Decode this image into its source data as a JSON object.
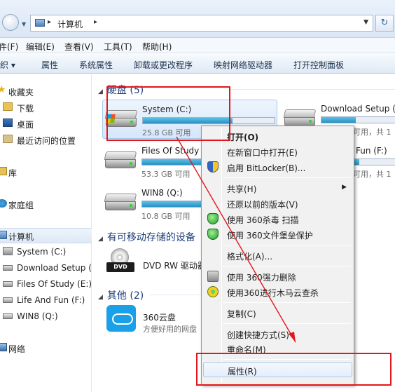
{
  "address": {
    "location": "计算机"
  },
  "menubar": [
    {
      "label": "件(F)"
    },
    {
      "label": "编辑(E)"
    },
    {
      "label": "查看(V)"
    },
    {
      "label": "工具(T)"
    },
    {
      "label": "帮助(H)"
    }
  ],
  "toolbar": [
    {
      "label": "组织 ▾"
    },
    {
      "label": "属性"
    },
    {
      "label": "系统属性"
    },
    {
      "label": "卸载或更改程序"
    },
    {
      "label": "映射网络驱动器"
    },
    {
      "label": "打开控制面板"
    }
  ],
  "nav": {
    "favorites": "收藏夹",
    "downloads": "下载",
    "desktop": "桌面",
    "recent": "最近访问的位置",
    "libraries": "库",
    "homegroup": "家庭组",
    "computer": "计算机",
    "drives": [
      {
        "label": "System (C:)"
      },
      {
        "label": "Download Setup (D:)"
      },
      {
        "label": "Files Of Study (E:)"
      },
      {
        "label": "Life And Fun (F:)"
      },
      {
        "label": "WIN8 (Q:)"
      }
    ],
    "network": "网络"
  },
  "content": {
    "groups": {
      "hdd": "硬盘 (5)",
      "removable": "有可移动存储的设备",
      "other": "其他 (2)"
    },
    "drives": [
      {
        "name": "System (C:)",
        "size": "25.8 GB 可用",
        "used": 0.68
      },
      {
        "name": "Files Of Study",
        "size": "53.3 GB 可用",
        "used": 0.55
      },
      {
        "name": "WIN8 (Q:)",
        "size": "10.8 GB 可用",
        "used": 0.72
      },
      {
        "name": "Download Setup (",
        "size": "可用，共 1",
        "used": 0.45
      },
      {
        "name": "Fun (F:)",
        "size": "可用，共 1",
        "used": 0.5
      }
    ],
    "dvd": {
      "name": "DVD RW 驱动器",
      "badge": "DVD"
    },
    "cloud": {
      "name": "360云盘",
      "desc": "方便好用的网盘"
    }
  },
  "context_menu": {
    "open": "打开(O)",
    "open_new_window": "在新窗口中打开(E)",
    "bitlocker": "启用 BitLocker(B)...",
    "share": "共享(H)",
    "restore": "还原以前的版本(V)",
    "scan360": "使用 360杀毒 扫描",
    "firewall360": "使用 360文件堡垒保护",
    "format": "格式化(A)...",
    "shred360": "使用 360强力删除",
    "trojan360": "使用360进行木马云查杀",
    "copy": "复制(C)",
    "shortcut": "创建快捷方式(S)",
    "rename": "重命名(M)",
    "properties": "属性(R)"
  },
  "colors": {
    "annotation": "#e3161b",
    "drive_bar": "#2a8fc2",
    "group_header": "#1e3e7a"
  }
}
